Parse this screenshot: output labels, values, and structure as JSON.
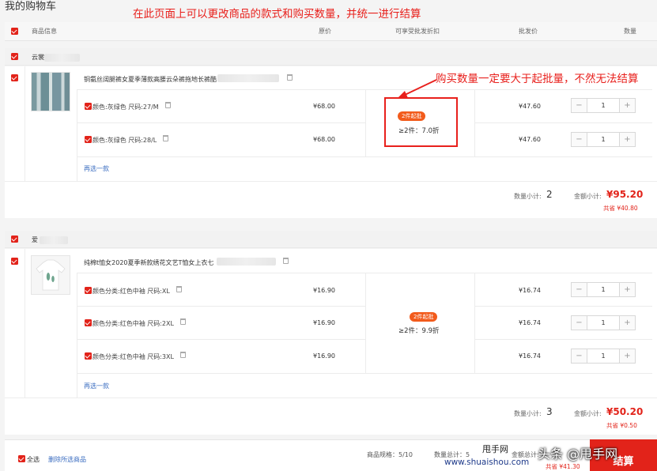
{
  "page_title": "我的购物车",
  "annotations": {
    "top": "在此页面上可以更改商品的款式和购买数量，并统一进行结算",
    "moq": "购买数量一定要大于起批量，不然无法结算"
  },
  "columns": {
    "product": "商品信息",
    "price": "原价",
    "discount": "可享受批发折扣",
    "wholesale": "批发价",
    "qty": "数量"
  },
  "shops": [
    {
      "name": "云裳",
      "product_title": "铜氨丝阔腿裤女夏季薄款高腰云朵裤拖地长裤酷",
      "skus": [
        {
          "spec": "颜色:灰绿色 尺码:27/M",
          "price": "¥68.00",
          "wholesale": "¥47.60",
          "qty": "1"
        },
        {
          "spec": "颜色:灰绿色 尺码:28/L",
          "price": "¥68.00",
          "wholesale": "¥47.60",
          "qty": "1"
        }
      ],
      "moq_badge": "2件起批",
      "discount_text": "≥2件：7.0折",
      "reselect": "再选一款",
      "qty_label": "数量小计:",
      "qty_total": "2",
      "amt_label": "金额小计:",
      "amt_total": "¥95.20",
      "saved": "共省 ¥40.80"
    },
    {
      "name": "爱",
      "product_title": "纯棉t恤女2020夏季新款绣花文艺T恤女上衣七",
      "skus": [
        {
          "spec": "颜色分类:红色中袖 尺码:XL",
          "price": "¥16.90",
          "wholesale": "¥16.74",
          "qty": "1"
        },
        {
          "spec": "颜色分类:红色中袖 尺码:2XL",
          "price": "¥16.90",
          "wholesale": "¥16.74",
          "qty": "1"
        },
        {
          "spec": "颜色分类:红色中袖 尺码:3XL",
          "price": "¥16.90",
          "wholesale": "¥16.74",
          "qty": "1"
        }
      ],
      "moq_badge": "2件起批",
      "discount_text": "≥2件：9.9折",
      "reselect": "再选一款",
      "qty_label": "数量小计:",
      "qty_total": "3",
      "amt_label": "金额小计:",
      "amt_total": "¥50.20",
      "saved": "共省 ¥0.50"
    }
  ],
  "footer": {
    "select_all": "全选",
    "delete_selected": "删除所选商品",
    "spec_count": "商品规格：5/10",
    "qty_total": "数量总计：5",
    "amt_label": "金额总计:",
    "saved": "共省 ¥41.30",
    "checkout": "结算"
  },
  "watermarks": {
    "left_brand": "甩手网",
    "left_url": "www.shuaishou.com",
    "right": "头条 @甩手网"
  },
  "colors": {
    "accent": "#e2231a",
    "annotation": "#e8201c",
    "badge": "#f25b1c",
    "link": "#3a6cc0"
  }
}
